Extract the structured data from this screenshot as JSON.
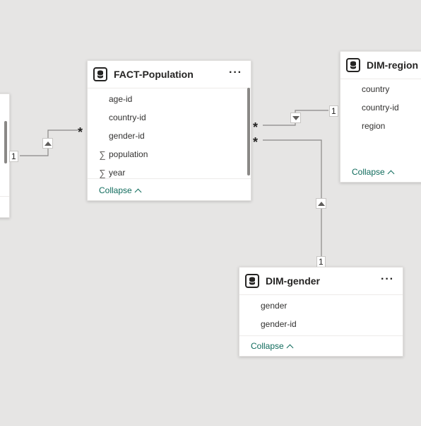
{
  "tables": {
    "fact_population": {
      "title": "FACT-Population",
      "more": "···",
      "fields": [
        {
          "name": "age-id",
          "sigma": ""
        },
        {
          "name": "country-id",
          "sigma": ""
        },
        {
          "name": "gender-id",
          "sigma": ""
        },
        {
          "name": "population",
          "sigma": "∑"
        },
        {
          "name": "year",
          "sigma": "∑"
        }
      ],
      "collapse": "Collapse"
    },
    "dim_region": {
      "title": "DIM-region",
      "fields": [
        {
          "name": "country"
        },
        {
          "name": "country-id"
        },
        {
          "name": "region"
        }
      ],
      "collapse": "Collapse"
    },
    "dim_gender": {
      "title": "DIM-gender",
      "more": "···",
      "fields": [
        {
          "name": "gender"
        },
        {
          "name": "gender-id"
        }
      ],
      "collapse": "Collapse"
    }
  },
  "relationships": {
    "left_to_fact": {
      "one": "1",
      "many": "*"
    },
    "fact_to_region": {
      "one": "1",
      "many": "*"
    },
    "fact_to_gender": {
      "one": "1",
      "many": "*"
    }
  }
}
